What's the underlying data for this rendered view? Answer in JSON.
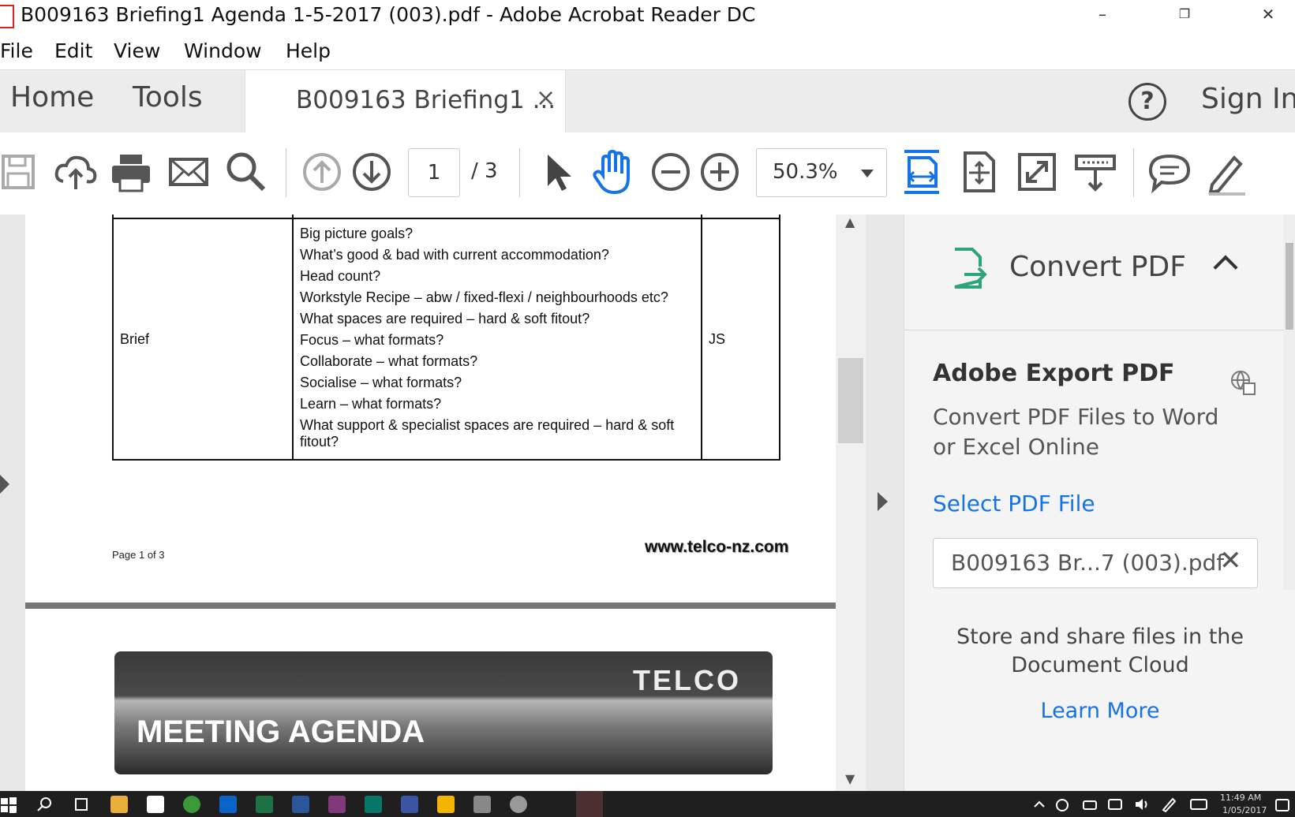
{
  "window": {
    "title": "B009163 Briefing1 Agenda 1-5-2017 (003).pdf - Adobe Acrobat Reader DC",
    "minimize": "–",
    "restore": "❐",
    "close": "✕"
  },
  "menu": [
    "File",
    "Edit",
    "View",
    "Window",
    "Help"
  ],
  "tabs": {
    "home": "Home",
    "tools": "Tools",
    "document": "B009163 Briefing1 ...",
    "document_close": "×",
    "help": "?",
    "signin": "Sign In"
  },
  "toolbar": {
    "current_page": "1",
    "total_pages": "/ 3",
    "zoom": "50.3%"
  },
  "document": {
    "table": {
      "topic": "Brief",
      "owner": "JS",
      "questions": [
        "Big picture goals?",
        "What’s good & bad with current accommodation?",
        "Head count?",
        "Workstyle Recipe – abw / fixed-flexi / neighbourhoods etc?",
        "What spaces are required – hard & soft fitout?",
        "Focus – what formats?",
        "Collaborate – what formats?",
        "Socialise – what formats?",
        "Learn – what formats?",
        "What support & specialist spaces are required – hard & soft",
        "fitout?"
      ]
    },
    "page_label": "Page 1 of 3",
    "website": "www.telco-nz.com",
    "banner_logo": "TELCO",
    "banner_heading": "MEETING AGENDA"
  },
  "right_panel": {
    "title": "Convert PDF",
    "export_title": "Adobe Export PDF",
    "export_desc_1": "Convert PDF Files to Word",
    "export_desc_2": "or Excel Online",
    "select_link": "Select PDF File",
    "selected_file": "B009163 Br...7 (003).pdf",
    "clear": "✕",
    "store_1": "Store and share files in the",
    "store_2": "Document Cloud",
    "learn_more": "Learn More"
  },
  "taskbar": {
    "time": "11:49 AM",
    "date": "1/05/2017"
  },
  "colors": {
    "accent_blue": "#1473e6",
    "convert_green": "#2fa37a"
  }
}
